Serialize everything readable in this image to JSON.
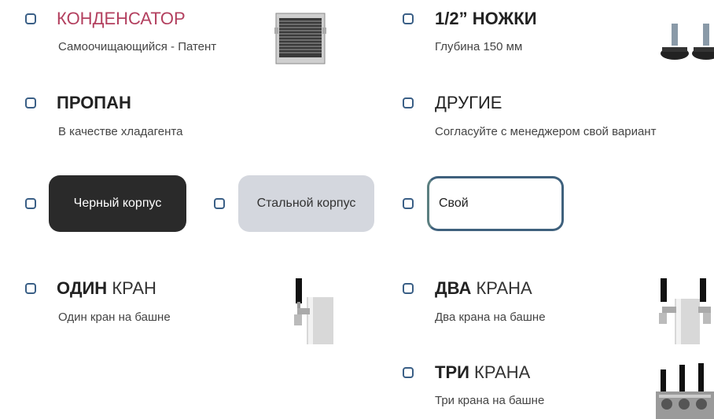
{
  "options": {
    "condenser": {
      "title": "КОНДЕНСАТОР",
      "subtitle": "Самоочищающийся - Патент"
    },
    "legs": {
      "title": "1/2” НОЖКИ",
      "subtitle": "Глубина 150 мм"
    },
    "propane": {
      "title": "ПРОПАН",
      "subtitle": "В качестве хладагента"
    },
    "other": {
      "title": "ДРУГИЕ",
      "subtitle": "Согласуйте с менеджером свой вариант"
    },
    "one_tap": {
      "title_bold": "ОДИН",
      "title_rest": " КРАН",
      "subtitle": "Один кран на башне"
    },
    "two_taps": {
      "title_bold": "ДВА",
      "title_rest": " КРАНА",
      "subtitle": "Два крана на башне"
    },
    "three_taps": {
      "title_bold": "ТРИ",
      "title_rest": " КРАНА",
      "subtitle": "Три крана на башне"
    }
  },
  "body_options": {
    "black": "Черный корпус",
    "steel": "Стальной корпус",
    "custom": "Свой"
  },
  "colors": {
    "accent": "#b3405f",
    "checkbox_border": "#3a5f86",
    "chip_black": "#2a2a2a",
    "chip_steel": "#d4d7de"
  },
  "icons": {
    "condenser": "condenser-image",
    "legs": "legs-image",
    "one_tap": "one-tap-image",
    "two_taps": "two-taps-image",
    "three_taps": "three-taps-image"
  }
}
